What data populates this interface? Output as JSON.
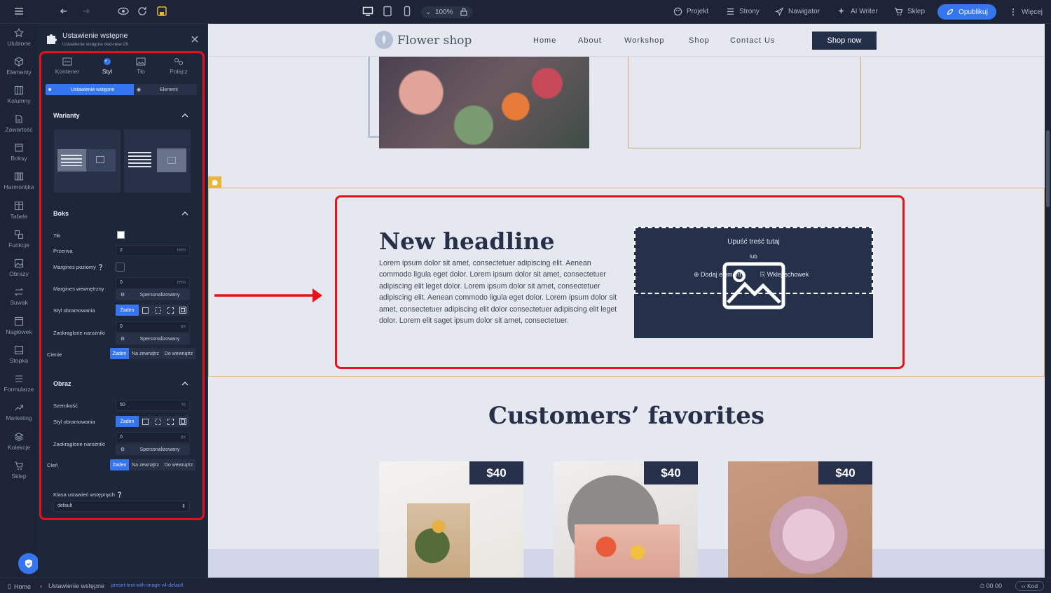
{
  "topbar": {
    "zoom": "100%",
    "nav": [
      {
        "label": "Projekt",
        "icon": "palette-icon"
      },
      {
        "label": "Strony",
        "icon": "list-icon"
      },
      {
        "label": "Nawigator",
        "icon": "navigator-icon"
      },
      {
        "label": "AI Writer",
        "icon": "sparkle-icon"
      },
      {
        "label": "Sklep",
        "icon": "cart-icon"
      }
    ],
    "publish": "Opublikuj",
    "more": "Więcej"
  },
  "rail": [
    {
      "label": "Ulubione",
      "icon": "star-icon"
    },
    {
      "label": "Elementy",
      "icon": "cube-icon"
    },
    {
      "label": "Kolumny",
      "icon": "columns-icon"
    },
    {
      "label": "Zawartość",
      "icon": "document-icon"
    },
    {
      "label": "Boksy",
      "icon": "box-icon"
    },
    {
      "label": "Harmonijka",
      "icon": "accordion-icon"
    },
    {
      "label": "Tabele",
      "icon": "table-icon"
    },
    {
      "label": "Funkcje",
      "icon": "functions-icon"
    },
    {
      "label": "Obrazy",
      "icon": "image-icon"
    },
    {
      "label": "Suwak",
      "icon": "slider-icon"
    },
    {
      "label": "Nagłówek",
      "icon": "header-icon"
    },
    {
      "label": "Stopka",
      "icon": "footer-icon"
    },
    {
      "label": "Formularze",
      "icon": "form-icon"
    },
    {
      "label": "Marketing",
      "icon": "trend-icon"
    },
    {
      "label": "Kolekcje",
      "icon": "layers-icon"
    },
    {
      "label": "Sklep",
      "icon": "cart-icon"
    }
  ],
  "panel": {
    "title": "Ustawienie wstępne",
    "subtitle": "Ustawienie wstępne #ed-new-28",
    "tabs": [
      "Kontener",
      "Styl",
      "Tło",
      "Połącz"
    ],
    "active_tab": "Styl",
    "subtabs": [
      "Ustawienie wstępne",
      "Element"
    ],
    "variants_title": "Warianty",
    "box": {
      "title": "Boks",
      "bg_label": "Tło",
      "gap_label": "Przerwa",
      "gap_value": "2",
      "gap_unit": "rem",
      "hmargin_label": "Margines poziomy",
      "padding_label": "Margines wewnętrzny",
      "padding_value": "0",
      "padding_unit": "rem",
      "custom": "Spersonalizowany",
      "border_label": "Styl obramowania",
      "border_none": "Żaden",
      "radius_label": "Zaokrąglone narożniki",
      "radius_value": "0",
      "radius_unit": "px",
      "shadow_label": "Cienie",
      "shadow_options": [
        "Żaden",
        "Na zewnątrz",
        "Do wewnątrz"
      ]
    },
    "image": {
      "title": "Obraz",
      "width_label": "Szerokość",
      "width_value": "50",
      "width_unit": "%",
      "border_label": "Styl obramowania",
      "border_none": "Żaden",
      "radius_label": "Zaokrąglone narożniki",
      "radius_value": "0",
      "radius_unit": "px",
      "custom": "Spersonalizowany",
      "shadow_label": "Cień",
      "shadow_options": [
        "Żaden",
        "Na zewnątrz",
        "Do wewnątrz"
      ]
    },
    "preset_class_label": "Klasa ustawień wstępnych",
    "preset_class_value": "default"
  },
  "site": {
    "logo": "Flower shop",
    "nav": [
      "Home",
      "About",
      "Workshop",
      "Shop",
      "Contact Us"
    ],
    "cta": "Shop now",
    "headline": "New headline",
    "body": "Lorem ipsum dolor sit amet, consectetuer adipiscing elit. Aenean commodo ligula eget dolor. Lorem ipsum dolor sit amet, consectetuer adipiscing elit leget dolor. Lorem ipsum dolor sit amet, consectetuer adipiscing elit. Aenean commodo ligula eget dolor. Lorem ipsum dolor sit amet, consectetuer adipiscing elit dolor consectetuer adipiscing elit leget dolor. Lorem elit saget ipsum dolor sit amet, consectetuer.",
    "dropzone": {
      "title": "Upuść treść tutaj",
      "or": "lub",
      "add": "Dodaj elementy",
      "paste": "Wklej schowek"
    },
    "favorites_title": "Customers’ favorites",
    "prices": [
      "$40",
      "$40",
      "$40"
    ]
  },
  "bottombar": {
    "home": "Home",
    "crumb": "Ustawienie wstępne",
    "preset": ".preset-text-with-image-v4-default",
    "time": "00 00",
    "code": "Kod"
  },
  "colors": {
    "accent": "#3576f0",
    "highlight": "#e8121c",
    "navy": "#26304a"
  }
}
